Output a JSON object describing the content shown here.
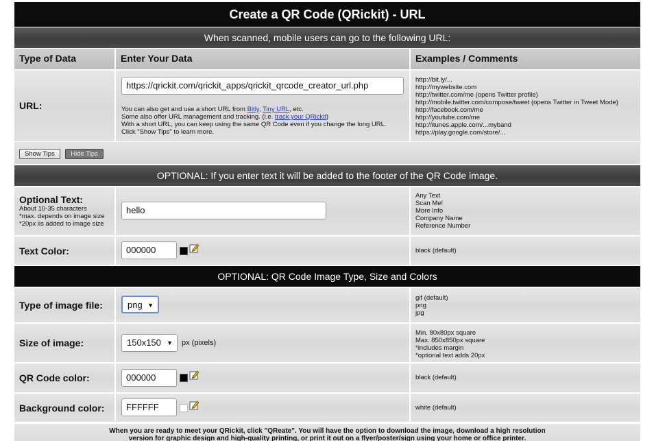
{
  "title": "Create a QR Code (QRickit) - URL",
  "url_section": {
    "heading": "When scanned, mobile users can go to the following URL:",
    "col_headers": [
      "Type of Data",
      "Enter Your Data",
      "Examples / Comments"
    ],
    "label": "URL:",
    "value": "https://qrickit.com/qrickit_apps/qrickit_qrcode_creator_url.php",
    "help_line1_prefix": "You can also get and use a short URL from ",
    "help_link_bitly": "Bitly",
    "help_comma": ", ",
    "help_link_tinyurl": "Tiny URL",
    "help_line1_suffix": ", etc.",
    "help_line2_prefix": "Some also offer URL management and tracking. (i.e. ",
    "help_link_track": "track your QRickit",
    "help_line2_suffix": ")",
    "help_line3": "With a short URL, you can keep using the same QR Code even if you change the long URL.",
    "help_line4": "Click \"Show Tips\" to learn more.",
    "examples": [
      "http://bit.ly/...",
      "http://mywebsite.com",
      "http://twitter.com/me (opens Twitter profile)",
      "http://mobile.twitter.com/compose/tweet (opens Twitter in Tweet Mode)",
      "http://facebook.com/me",
      "http://youtube.com/me",
      "http://itunes.apple.com/...myband",
      "https://play.google.com/store/..."
    ],
    "show_tips": "Show Tips",
    "hide_tips": "Hide Tips"
  },
  "optional_text_section": {
    "heading": "OPTIONAL: If you enter text it will be added to the footer of the QR Code image.",
    "label": "Optional Text:",
    "notes": [
      "About 10-35 characters",
      "*max. depends on image size",
      "*20px iis added to image size"
    ],
    "value": "hello",
    "examples": [
      "Any Text",
      "Scan Me!",
      "More Info",
      "Company Name",
      "Reference Number"
    ],
    "text_color_label": "Text Color:",
    "text_color_value": "000000",
    "text_color_comment": "black (default)",
    "text_color_swatch": "#000000"
  },
  "image_section": {
    "heading": "OPTIONAL: QR Code Image Type, Size and Colors",
    "type_label": "Type of image file:",
    "type_value": "png",
    "type_examples": [
      "gif (default)",
      "png",
      "jpg"
    ],
    "size_label": "Size of image:",
    "size_value": "150x150",
    "size_unit": "px (pixels)",
    "size_examples": [
      "Min. 80x80px square",
      "Max. 850x850px square",
      "*includes margin",
      "*optional text adds 20px"
    ],
    "qr_color_label": "QR Code color:",
    "qr_color_value": "000000",
    "qr_color_comment": "black (default)",
    "qr_color_swatch": "#000000",
    "bg_color_label": "Background color:",
    "bg_color_value": "FFFFFF",
    "bg_color_comment": "white (default)",
    "bg_color_swatch": "#FFFFFF"
  },
  "footer": {
    "line1": "When you are ready to meet your QRickit, click \"QReate\". You will have the option to download the image, download a high resolution",
    "line2": "version for graphic design and high-quality printing, or print it out on a flyer/poster/sign using your home or office printer."
  }
}
